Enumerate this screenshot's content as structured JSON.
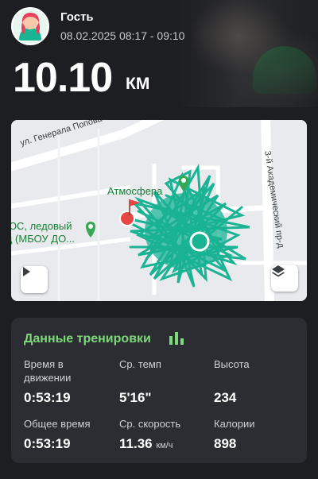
{
  "header": {
    "user_name": "Гость",
    "session_time": "08.02.2025 08:17 - 09:10",
    "avatar_icon": "user-avatar-illustration"
  },
  "distance": {
    "value": "10.10",
    "unit": "КМ"
  },
  "map": {
    "streets": [
      "ул. Генерала Попова",
      "3-й Академический пр-д"
    ],
    "pois": [
      {
        "label": "Атмосфера",
        "icon": "map-pin-icon"
      },
      {
        "label": "ЮС, ледовый",
        "icon": "map-pin-icon"
      },
      {
        "label": "ц (МБОУ ДО...",
        "icon": "none"
      }
    ],
    "route_color": "#1ab394",
    "play_icon": "play-icon",
    "layers_icon": "layers-icon",
    "start_icon": "start-flag-icon",
    "end_icon": "end-point-icon"
  },
  "stats": {
    "title": "Данные тренировки",
    "title_icon": "bar-chart-icon",
    "accent_color": "#7ed97a",
    "items": [
      {
        "label": "Время в движении",
        "value": "0:53:19",
        "unit": ""
      },
      {
        "label": "Ср. темп",
        "value": "5'16\"",
        "unit": ""
      },
      {
        "label": "Высота",
        "value": "234",
        "unit": ""
      },
      {
        "label": "Общее время",
        "value": "0:53:19",
        "unit": ""
      },
      {
        "label": "Ср. скорость",
        "value": "11.36",
        "unit": "км/ч"
      },
      {
        "label": "Калории",
        "value": "898",
        "unit": ""
      }
    ]
  }
}
